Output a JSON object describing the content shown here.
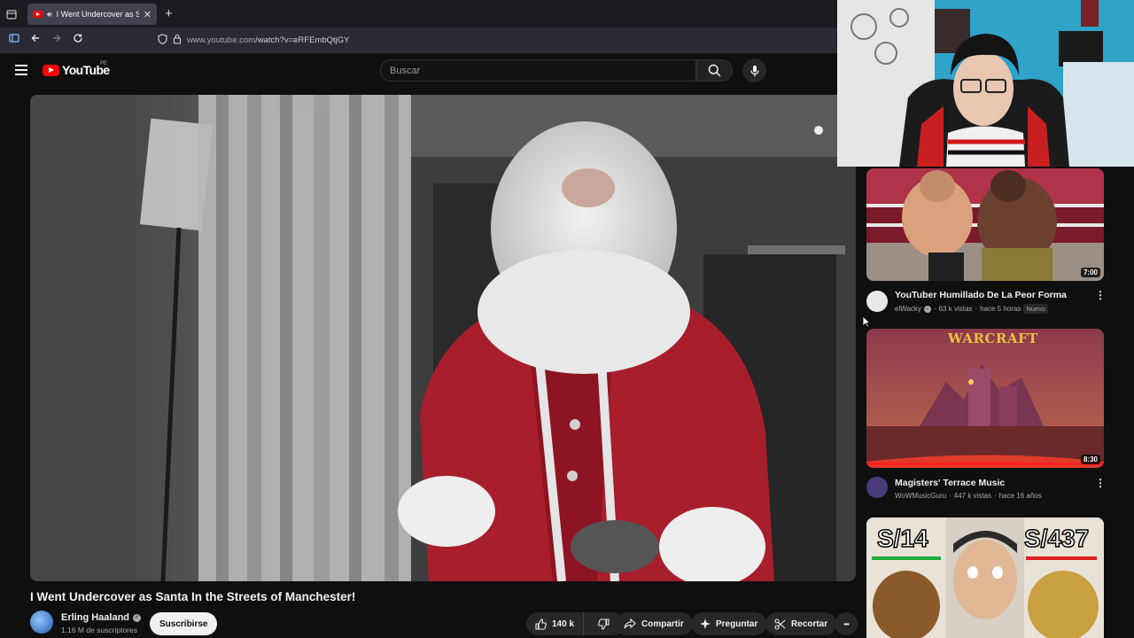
{
  "browser": {
    "tab_title": "I Went Undercover as Santa In the Streets of Manchester! - YouTube",
    "url_host": "www.youtube.com",
    "url_path": "/watch?v=eRFEmbQtjGY",
    "icons": [
      "tab-overview-icon",
      "speaker-icon",
      "close-icon",
      "plus-icon",
      "sidebar-icon",
      "back-arrow-icon",
      "forward-arrow-icon",
      "reload-icon",
      "shield-icon",
      "lock-icon"
    ]
  },
  "header": {
    "logo_text": "YouTube",
    "country_code": "PE",
    "search_placeholder": "Buscar",
    "icons": [
      "menu-icon",
      "search-icon",
      "mic-icon"
    ]
  },
  "video": {
    "title": "I Went Undercover as Santa In the Streets of Manchester!",
    "channel_name": "Erling Haaland",
    "subscribers": "1.16 M de suscriptores",
    "subscribe_label": "Suscribirse",
    "like_count": "140 k",
    "share_label": "Compartir",
    "ask_label": "Preguntar",
    "clip_label": "Recortar",
    "more_symbol": "•••"
  },
  "recommendations": [
    {
      "title": "YouTuber Humillado De La Peor Forma",
      "channel": "elWacky",
      "views": "63 k vistas",
      "age": "hace 5 horas",
      "badge": "Nuevo",
      "duration": "7:00",
      "menu": "⋮"
    },
    {
      "title": "Magisters' Terrace Music",
      "channel": "WoWMusicGuru",
      "views": "447 k vistas",
      "age": "hace 16 años",
      "duration": "8:30",
      "menu": "⋮",
      "thumb_banner": "WARCRAFT"
    },
    {
      "price_left": "S/14",
      "price_right": "S/437"
    }
  ],
  "colors": {
    "background": "#0f0f0f",
    "brand_red": "#ff0000",
    "pill": "#272727",
    "text_primary": "#f1f1f1",
    "text_secondary": "#aaaaaa"
  }
}
